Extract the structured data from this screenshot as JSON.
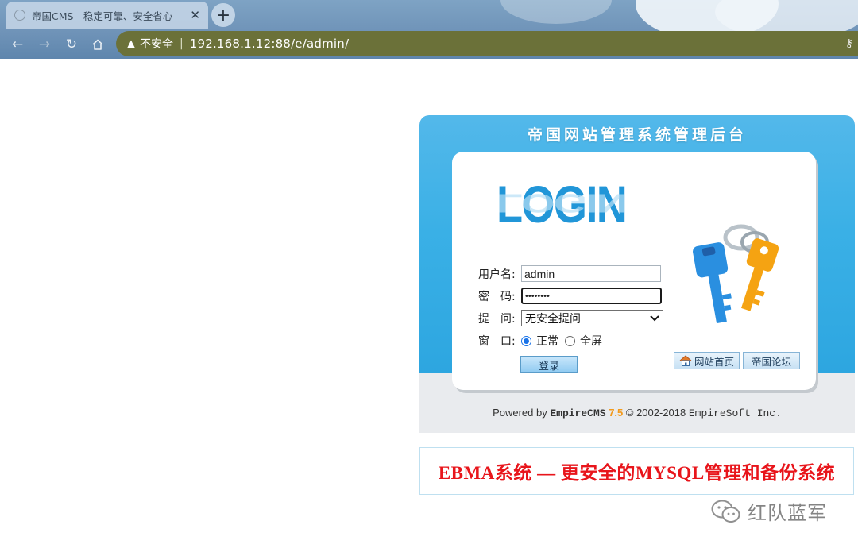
{
  "browser": {
    "tab_title": "帝国CMS - 稳定可靠、安全省心",
    "tab_close": "✕",
    "new_tab": "+",
    "security_label": "不安全",
    "separator": "|",
    "url": "192.168.1.12:88/e/admin/"
  },
  "login": {
    "header_title": "帝国网站管理系统管理后台",
    "login_word": "LOGIN",
    "username_label": "用户名:",
    "username_value": "admin",
    "password_label": "密　码:",
    "password_value": "••••••••",
    "question_label": "提　问:",
    "question_selected": "无安全提问",
    "window_label": "窗　口:",
    "window_option_normal": "正常",
    "window_option_fullscreen": "全屏",
    "window_selected": "正常",
    "login_button": "登录",
    "site_home_button": "网站首页",
    "forum_button": "帝国论坛"
  },
  "footer": {
    "powered_prefix": "Powered by ",
    "brand": "EmpireCMS",
    "version": "7.5",
    "copyright": "© 2002-2018",
    "company": "EmpireSoft Inc."
  },
  "banner": {
    "text": "EBMA系统 — 更安全的MYSQL管理和备份系统"
  },
  "watermark": {
    "text": "红队蓝军"
  },
  "icons": {
    "favicon": "globe-icon",
    "back": "arrow-left-icon",
    "forward": "arrow-right-icon",
    "reload": "reload-icon",
    "home": "home-icon",
    "warning": "warning-icon",
    "key": "key-icon",
    "keys_illustration": "keys-icon",
    "wechat": "wechat-icon"
  },
  "colors": {
    "panel_blue": "#3ab0e6",
    "login_blue": "#2196d8",
    "version_orange": "#f29a1c",
    "banner_red": "#e8151b",
    "omnibox": "#6b7139"
  }
}
